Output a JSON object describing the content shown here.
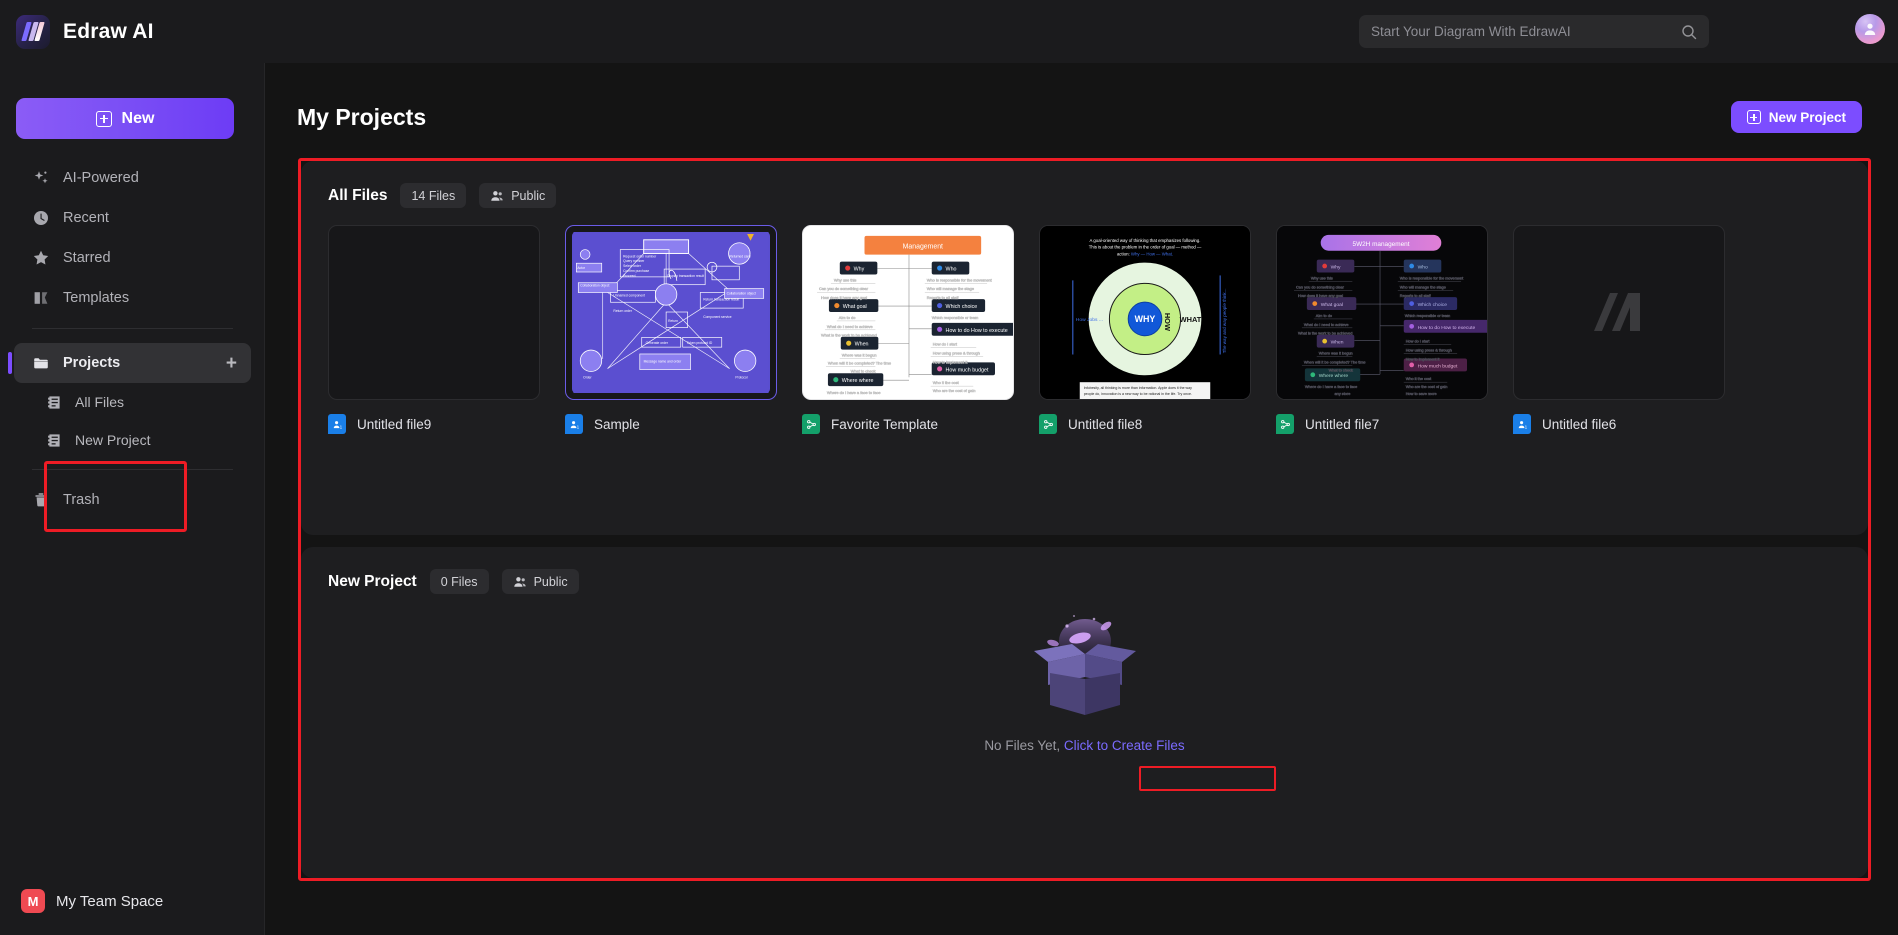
{
  "app": {
    "brand": "Edraw AI",
    "logo_icon": "edraw-logo-icon"
  },
  "search": {
    "placeholder": "Start Your Diagram With EdrawAI",
    "value": "",
    "icon": "search-icon"
  },
  "account": {
    "avatar_icon": "user-avatar-icon"
  },
  "sidebar": {
    "new_button": "New",
    "items": [
      {
        "label": "AI-Powered",
        "icon": "sparkle-icon"
      },
      {
        "label": "Recent",
        "icon": "clock-icon"
      },
      {
        "label": "Starred",
        "icon": "star-icon"
      },
      {
        "label": "Templates",
        "icon": "templates-icon"
      }
    ],
    "projects": {
      "label": "Projects",
      "icon": "folder-icon",
      "add_icon": "plus-icon"
    },
    "sub_items": [
      {
        "label": "All Files",
        "icon": "file-list-icon"
      },
      {
        "label": "New Project",
        "icon": "file-list-icon"
      }
    ],
    "trash": {
      "label": "Trash",
      "icon": "trash-icon"
    },
    "team": {
      "badge": "M",
      "label": "My Team Space"
    }
  },
  "main": {
    "title": "My Projects",
    "new_project_button": "New Project"
  },
  "panels": [
    {
      "name": "All Files",
      "count": "14 Files",
      "visibility": "Public",
      "cards": [
        {
          "label": "Untitled file9",
          "type_color": "#1a7fe8",
          "thumb": "blank-dark"
        },
        {
          "label": "Sample",
          "type_color": "#1a7fe8",
          "thumb": "uml-purple"
        },
        {
          "label": "Favorite Template",
          "type_color": "#14a06a",
          "thumb": "mindmap-light"
        },
        {
          "label": "Untitled file8",
          "type_color": "#14a06a",
          "thumb": "golden-circle"
        },
        {
          "label": "Untitled file7",
          "type_color": "#14a06a",
          "thumb": "mindmap-dark"
        },
        {
          "label": "Untitled file6",
          "type_color": "#1a7fe8",
          "thumb": "logo-placeholder"
        }
      ]
    },
    {
      "name": "New Project",
      "count": "0 Files",
      "visibility": "Public",
      "empty_text": "No Files Yet,",
      "empty_link": "Click to Create Files",
      "empty_icon": "open-box-icon"
    }
  ],
  "highlights": {
    "color": "#ee1c25",
    "regions": [
      "sidebar-sub-items",
      "projects-content-area",
      "create-files-link"
    ]
  },
  "thumb_art": {
    "uml": {
      "title": "",
      "labels": [
        "Collaboration object",
        "Collaboration object",
        "Message name and order",
        "Actor",
        "Object",
        "Returned card",
        "Protocol",
        "Return order"
      ]
    },
    "mindmap_light": {
      "root": "Management",
      "branches": [
        {
          "label": "Why",
          "children": [
            "Why use this",
            "Can you do something clear",
            "How does it have any goal"
          ]
        },
        {
          "label": "Who",
          "children": [
            "Who is responsible for the movement",
            "Who will manage the stage",
            "Reports to all staff"
          ]
        },
        {
          "label": "What goal",
          "children": [
            "Aim to do",
            "What do I need to achieve",
            "What is the work to be achieved"
          ]
        },
        {
          "label": "Which choice",
          "children": [
            "Which responsible or team"
          ]
        },
        {
          "label": "When",
          "children": [
            "When was it begun",
            "When will it be completed? The time",
            "What to check"
          ]
        },
        {
          "label": "How to do How to execute",
          "children": [
            "How do I start",
            "How using press & through",
            "How to implement it",
            "Which channel will I use any resource staff"
          ]
        },
        {
          "label": "Where where",
          "children": [
            "Where do I have a face to face",
            "any store"
          ]
        },
        {
          "label": "How much budget",
          "children": [
            "Who it the cost",
            "Who are the cost of gain",
            "How to save more"
          ]
        }
      ]
    },
    "golden_circle": {
      "center": "WHY",
      "middle": "HOW",
      "outer": "WHAT",
      "caption": "A goal-oriented way of thinking that emphasizes following. This is about the problem in the order of goal — method — action: Why — How — What.",
      "left_note": "How Jobs ...",
      "right_note": "The way and way people think..."
    },
    "mindmap_dark": {
      "root": "5W2H management"
    }
  }
}
